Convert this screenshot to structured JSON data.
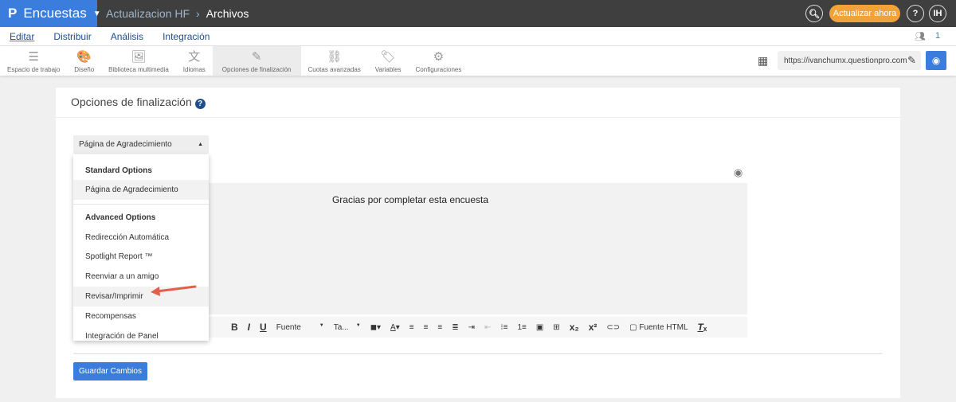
{
  "header": {
    "brand": "Encuestas",
    "project": "Actualizacion HF",
    "folder": "Archivos",
    "update_label": "Actualizar ahora",
    "help": "?",
    "avatar": "IH"
  },
  "nav": {
    "items": [
      "Editar",
      "Distribuir",
      "Análisis",
      "Integración"
    ],
    "active": "Editar",
    "users_count": "1"
  },
  "toolbar": {
    "items": [
      {
        "label": "Espacio de trabajo",
        "icon": "☰"
      },
      {
        "label": "Diseño",
        "icon": "🎨"
      },
      {
        "label": "Biblioteca multimedia",
        "icon": "🖼"
      },
      {
        "label": "Idiomas",
        "icon": "文"
      },
      {
        "label": "Opciones de finalización",
        "icon": "✎"
      },
      {
        "label": "Cuotas avanzadas",
        "icon": "⛓"
      },
      {
        "label": "Variables",
        "icon": "🏷"
      },
      {
        "label": "Configuraciones",
        "icon": "⚙"
      }
    ],
    "selected": "Opciones de finalización",
    "url": "https://ivanchumx.questionpro.com"
  },
  "main": {
    "title": "Opciones de finalización",
    "select_value": "Página de Agradecimiento",
    "menu": {
      "standard_header": "Standard Options",
      "standard": [
        "Página de Agradecimiento"
      ],
      "advanced_header": "Advanced Options",
      "advanced": [
        "Redirección Automática",
        "Spotlight Report ™",
        "Reenviar a un amigo",
        "Revisar/Imprimir",
        "Recompensas",
        "Integración de Panel"
      ],
      "highlighted": "Revisar/Imprimir"
    },
    "editor_text": "Gracias por completar esta encuesta",
    "editor_toolbar": {
      "font": "Fuente",
      "size": "Ta...",
      "source": "Fuente HTML"
    },
    "save_label": "Guardar Cambios"
  },
  "colors": {
    "brand": "#3b7ddd",
    "topbar": "#3f3f3f",
    "update": "#f0a33a",
    "arrow": "#e0604a"
  }
}
